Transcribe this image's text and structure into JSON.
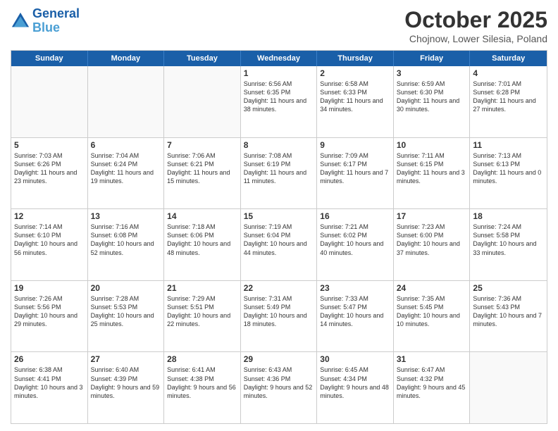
{
  "header": {
    "logo_line1": "General",
    "logo_line2": "Blue",
    "month": "October 2025",
    "location": "Chojnow, Lower Silesia, Poland"
  },
  "days": [
    "Sunday",
    "Monday",
    "Tuesday",
    "Wednesday",
    "Thursday",
    "Friday",
    "Saturday"
  ],
  "weeks": [
    [
      {
        "date": "",
        "sunrise": "",
        "sunset": "",
        "daylight": ""
      },
      {
        "date": "",
        "sunrise": "",
        "sunset": "",
        "daylight": ""
      },
      {
        "date": "",
        "sunrise": "",
        "sunset": "",
        "daylight": ""
      },
      {
        "date": "1",
        "sunrise": "Sunrise: 6:56 AM",
        "sunset": "Sunset: 6:35 PM",
        "daylight": "Daylight: 11 hours and 38 minutes."
      },
      {
        "date": "2",
        "sunrise": "Sunrise: 6:58 AM",
        "sunset": "Sunset: 6:33 PM",
        "daylight": "Daylight: 11 hours and 34 minutes."
      },
      {
        "date": "3",
        "sunrise": "Sunrise: 6:59 AM",
        "sunset": "Sunset: 6:30 PM",
        "daylight": "Daylight: 11 hours and 30 minutes."
      },
      {
        "date": "4",
        "sunrise": "Sunrise: 7:01 AM",
        "sunset": "Sunset: 6:28 PM",
        "daylight": "Daylight: 11 hours and 27 minutes."
      }
    ],
    [
      {
        "date": "5",
        "sunrise": "Sunrise: 7:03 AM",
        "sunset": "Sunset: 6:26 PM",
        "daylight": "Daylight: 11 hours and 23 minutes."
      },
      {
        "date": "6",
        "sunrise": "Sunrise: 7:04 AM",
        "sunset": "Sunset: 6:24 PM",
        "daylight": "Daylight: 11 hours and 19 minutes."
      },
      {
        "date": "7",
        "sunrise": "Sunrise: 7:06 AM",
        "sunset": "Sunset: 6:21 PM",
        "daylight": "Daylight: 11 hours and 15 minutes."
      },
      {
        "date": "8",
        "sunrise": "Sunrise: 7:08 AM",
        "sunset": "Sunset: 6:19 PM",
        "daylight": "Daylight: 11 hours and 11 minutes."
      },
      {
        "date": "9",
        "sunrise": "Sunrise: 7:09 AM",
        "sunset": "Sunset: 6:17 PM",
        "daylight": "Daylight: 11 hours and 7 minutes."
      },
      {
        "date": "10",
        "sunrise": "Sunrise: 7:11 AM",
        "sunset": "Sunset: 6:15 PM",
        "daylight": "Daylight: 11 hours and 3 minutes."
      },
      {
        "date": "11",
        "sunrise": "Sunrise: 7:13 AM",
        "sunset": "Sunset: 6:13 PM",
        "daylight": "Daylight: 11 hours and 0 minutes."
      }
    ],
    [
      {
        "date": "12",
        "sunrise": "Sunrise: 7:14 AM",
        "sunset": "Sunset: 6:10 PM",
        "daylight": "Daylight: 10 hours and 56 minutes."
      },
      {
        "date": "13",
        "sunrise": "Sunrise: 7:16 AM",
        "sunset": "Sunset: 6:08 PM",
        "daylight": "Daylight: 10 hours and 52 minutes."
      },
      {
        "date": "14",
        "sunrise": "Sunrise: 7:18 AM",
        "sunset": "Sunset: 6:06 PM",
        "daylight": "Daylight: 10 hours and 48 minutes."
      },
      {
        "date": "15",
        "sunrise": "Sunrise: 7:19 AM",
        "sunset": "Sunset: 6:04 PM",
        "daylight": "Daylight: 10 hours and 44 minutes."
      },
      {
        "date": "16",
        "sunrise": "Sunrise: 7:21 AM",
        "sunset": "Sunset: 6:02 PM",
        "daylight": "Daylight: 10 hours and 40 minutes."
      },
      {
        "date": "17",
        "sunrise": "Sunrise: 7:23 AM",
        "sunset": "Sunset: 6:00 PM",
        "daylight": "Daylight: 10 hours and 37 minutes."
      },
      {
        "date": "18",
        "sunrise": "Sunrise: 7:24 AM",
        "sunset": "Sunset: 5:58 PM",
        "daylight": "Daylight: 10 hours and 33 minutes."
      }
    ],
    [
      {
        "date": "19",
        "sunrise": "Sunrise: 7:26 AM",
        "sunset": "Sunset: 5:56 PM",
        "daylight": "Daylight: 10 hours and 29 minutes."
      },
      {
        "date": "20",
        "sunrise": "Sunrise: 7:28 AM",
        "sunset": "Sunset: 5:53 PM",
        "daylight": "Daylight: 10 hours and 25 minutes."
      },
      {
        "date": "21",
        "sunrise": "Sunrise: 7:29 AM",
        "sunset": "Sunset: 5:51 PM",
        "daylight": "Daylight: 10 hours and 22 minutes."
      },
      {
        "date": "22",
        "sunrise": "Sunrise: 7:31 AM",
        "sunset": "Sunset: 5:49 PM",
        "daylight": "Daylight: 10 hours and 18 minutes."
      },
      {
        "date": "23",
        "sunrise": "Sunrise: 7:33 AM",
        "sunset": "Sunset: 5:47 PM",
        "daylight": "Daylight: 10 hours and 14 minutes."
      },
      {
        "date": "24",
        "sunrise": "Sunrise: 7:35 AM",
        "sunset": "Sunset: 5:45 PM",
        "daylight": "Daylight: 10 hours and 10 minutes."
      },
      {
        "date": "25",
        "sunrise": "Sunrise: 7:36 AM",
        "sunset": "Sunset: 5:43 PM",
        "daylight": "Daylight: 10 hours and 7 minutes."
      }
    ],
    [
      {
        "date": "26",
        "sunrise": "Sunrise: 6:38 AM",
        "sunset": "Sunset: 4:41 PM",
        "daylight": "Daylight: 10 hours and 3 minutes."
      },
      {
        "date": "27",
        "sunrise": "Sunrise: 6:40 AM",
        "sunset": "Sunset: 4:39 PM",
        "daylight": "Daylight: 9 hours and 59 minutes."
      },
      {
        "date": "28",
        "sunrise": "Sunrise: 6:41 AM",
        "sunset": "Sunset: 4:38 PM",
        "daylight": "Daylight: 9 hours and 56 minutes."
      },
      {
        "date": "29",
        "sunrise": "Sunrise: 6:43 AM",
        "sunset": "Sunset: 4:36 PM",
        "daylight": "Daylight: 9 hours and 52 minutes."
      },
      {
        "date": "30",
        "sunrise": "Sunrise: 6:45 AM",
        "sunset": "Sunset: 4:34 PM",
        "daylight": "Daylight: 9 hours and 48 minutes."
      },
      {
        "date": "31",
        "sunrise": "Sunrise: 6:47 AM",
        "sunset": "Sunset: 4:32 PM",
        "daylight": "Daylight: 9 hours and 45 minutes."
      },
      {
        "date": "",
        "sunrise": "",
        "sunset": "",
        "daylight": ""
      }
    ]
  ]
}
